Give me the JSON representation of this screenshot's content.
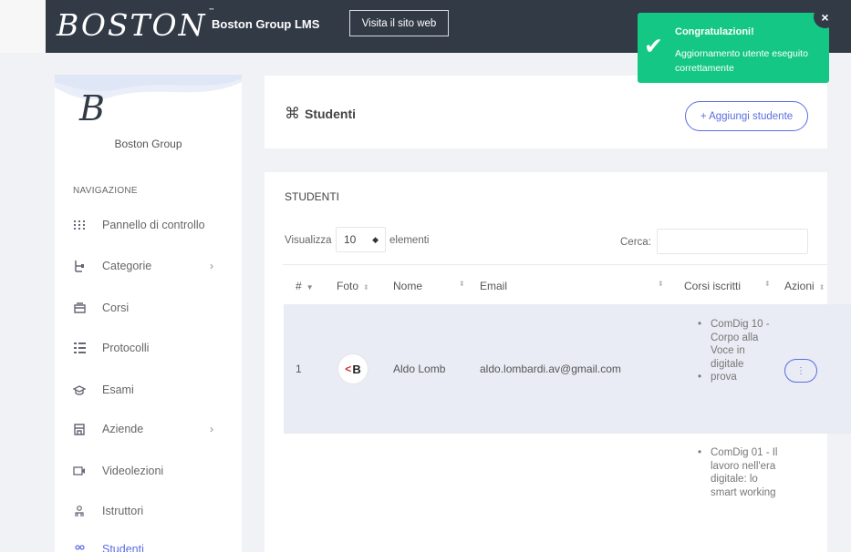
{
  "header": {
    "logo_text": "BOSTON",
    "logo_tm": "™",
    "app_title": "Boston Group LMS",
    "site_button": "Visita il sito web"
  },
  "sidebar": {
    "brand_letter": "B",
    "brand_name": "Boston Group",
    "nav_title": "NAVIGAZIONE",
    "items": [
      {
        "label": "Pannello di controllo",
        "icon": "grid-icon"
      },
      {
        "label": "Categorie",
        "icon": "hierarchy-icon",
        "submenu": true
      },
      {
        "label": "Corsi",
        "icon": "tray-icon"
      },
      {
        "label": "Protocolli",
        "icon": "list-icon"
      },
      {
        "label": "Esami",
        "icon": "graduation-cap-icon"
      },
      {
        "label": "Aziende",
        "icon": "building-icon",
        "submenu": true
      },
      {
        "label": "Videolezioni",
        "icon": "video-icon"
      },
      {
        "label": "Istruttori",
        "icon": "instructor-icon"
      },
      {
        "label": "Studenti",
        "icon": "students-icon"
      }
    ]
  },
  "page": {
    "title": "Studenti",
    "add_button": "+ Aggiungi studente"
  },
  "table": {
    "section_title": "STUDENTI",
    "show_label": "Visualizza",
    "page_length": "10",
    "elements_label": "elementi",
    "search_label": "Cerca:",
    "columns": [
      "#",
      "Foto",
      "Nome",
      "Email",
      "Corsi iscritti",
      "Azioni"
    ],
    "rows": [
      {
        "index": "1",
        "avatar_text": "B",
        "name": "Aldo Lomb",
        "email": "aldo.lombardi.av@gmail.com",
        "courses": [
          "ComDig 10 - Corpo alla Voce in digitale",
          "prova"
        ],
        "action": "⋮"
      },
      {
        "courses": [
          "ComDig 01 - Il lavoro nell'era digitale: lo smart working"
        ]
      }
    ]
  },
  "toast": {
    "title": "Congratulazioni!",
    "message": "Aggiornamento utente eseguito correttamente",
    "close": "×",
    "color": "#14c784"
  }
}
